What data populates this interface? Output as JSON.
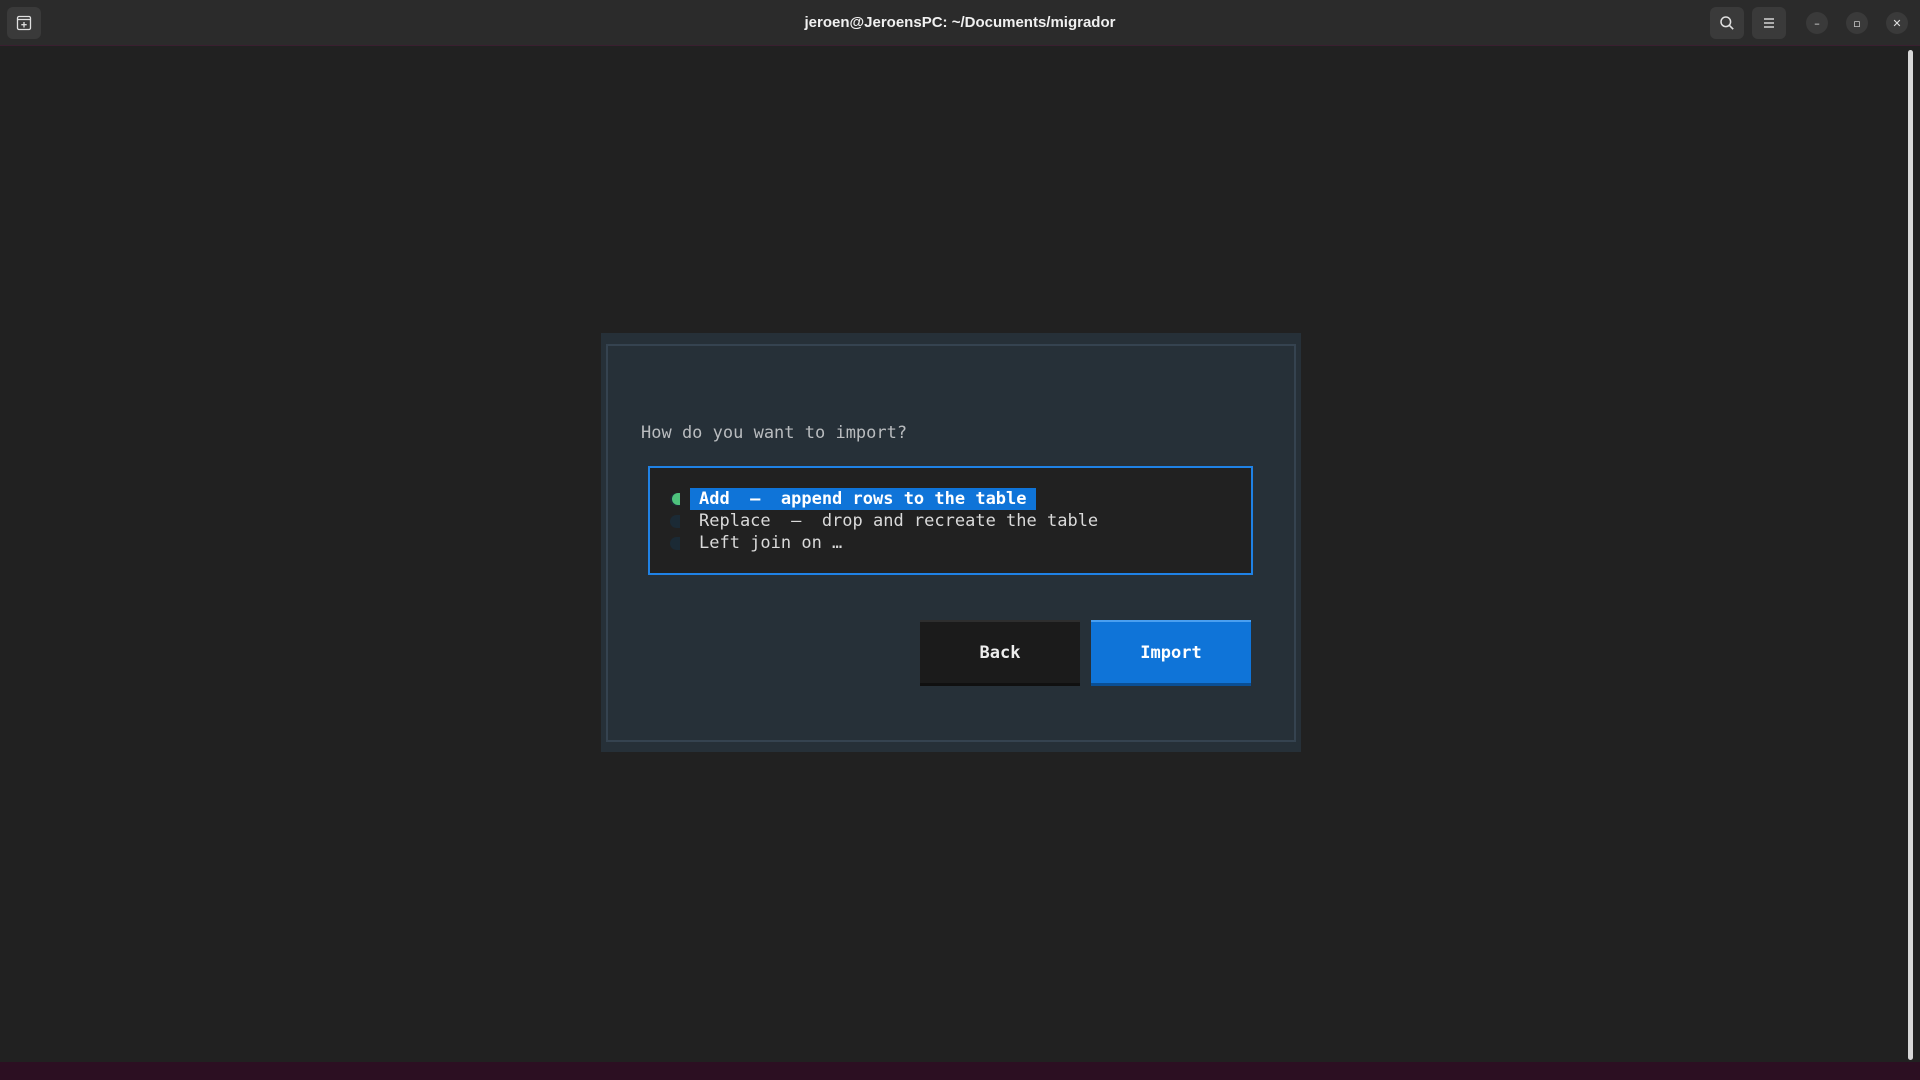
{
  "window": {
    "title": "jeroen@JeroensPC: ~/Documents/migrador",
    "left_button_icon": "new-tab-icon",
    "search_icon": "search-icon",
    "menu_icon": "hamburger-menu-icon",
    "minimize_glyph": "–",
    "maximize_glyph": "▫",
    "close_glyph": "✕"
  },
  "dialog": {
    "question": "How do you want to import?",
    "options": [
      {
        "label": "Add  —  append rows to the table",
        "selected": true
      },
      {
        "label": "Replace  —  drop and recreate the table",
        "selected": false
      },
      {
        "label": "Left join on …",
        "selected": false
      }
    ],
    "back_label": "Back",
    "import_label": "Import"
  },
  "colors": {
    "accent": "#0f74d8",
    "radio_selected": "#4ec27c",
    "dialog_bg": "#263038",
    "terminal_bg": "#212121"
  }
}
